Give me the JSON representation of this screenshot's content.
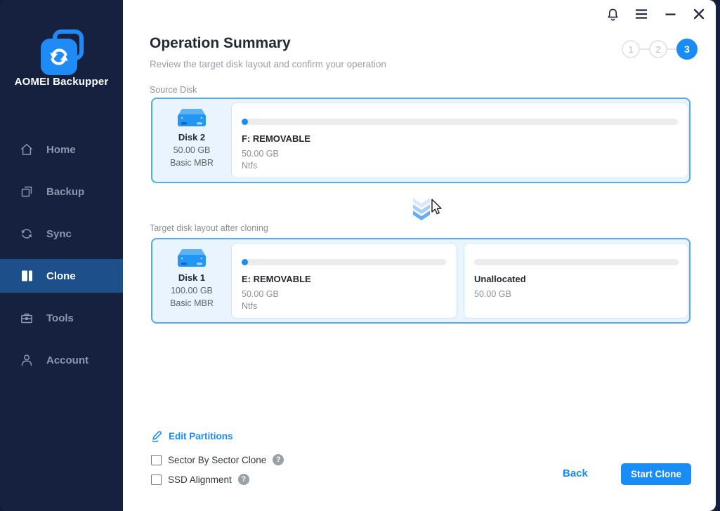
{
  "app": {
    "name": "AOMEI Backupper"
  },
  "titlebar": {
    "icons": [
      "notification-bell",
      "menu",
      "minimize",
      "close"
    ]
  },
  "sidebar": {
    "items": [
      {
        "label": "Home",
        "icon": "home-icon",
        "active": false
      },
      {
        "label": "Backup",
        "icon": "backup-icon",
        "active": false
      },
      {
        "label": "Sync",
        "icon": "sync-icon",
        "active": false
      },
      {
        "label": "Clone",
        "icon": "clone-icon",
        "active": true
      },
      {
        "label": "Tools",
        "icon": "tools-icon",
        "active": false
      },
      {
        "label": "Account",
        "icon": "account-icon",
        "active": false
      }
    ]
  },
  "header": {
    "title": "Operation Summary",
    "subtitle": "Review the target disk layout and confirm your operation",
    "steps": [
      "1",
      "2",
      "3"
    ],
    "active_step": "3"
  },
  "source_section": {
    "label": "Source Disk",
    "disk": {
      "name": "Disk 2",
      "size": "50.00 GB",
      "type": "Basic MBR"
    },
    "partitions": [
      {
        "name": "F: REMOVABLE",
        "size": "50.00 GB",
        "fs": "Ntfs",
        "used_fraction": 0.012
      }
    ]
  },
  "target_section": {
    "label": "Target disk layout after cloning",
    "disk": {
      "name": "Disk 1",
      "size": "100.00 GB",
      "type": "Basic MBR"
    },
    "partitions": [
      {
        "name": "E: REMOVABLE",
        "size": "50.00 GB",
        "fs": "Ntfs",
        "used_fraction": 0.025
      },
      {
        "name": "Unallocated",
        "size": "50.00 GB",
        "fs": "",
        "used_fraction": 0
      }
    ]
  },
  "footer": {
    "edit_partitions_label": "Edit Partitions",
    "checkboxes": [
      {
        "label": "Sector By Sector Clone",
        "checked": false,
        "help": "?"
      },
      {
        "label": "SSD Alignment",
        "checked": false,
        "help": "?"
      }
    ],
    "back_label": "Back",
    "start_label": "Start Clone"
  },
  "colors": {
    "accent": "#1a8cf8",
    "sidebar_bg": "#162140",
    "active_nav_bg": "#1d4f8b",
    "card_border": "#55a9ed",
    "card_bg": "#e9f4fe",
    "bar_track": "#ececec",
    "bar_fill": "#1e8bf7"
  }
}
